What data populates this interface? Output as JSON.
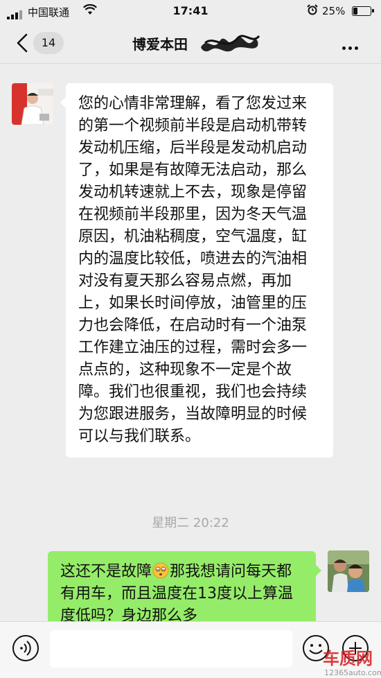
{
  "status_bar": {
    "carrier": "中国联通",
    "time": "17:41",
    "battery_percent": "25%",
    "battery_level": 0.25,
    "icons": [
      "signal-icon",
      "wifi-icon",
      "alarm-icon",
      "battery-icon"
    ]
  },
  "header": {
    "back_icon": "chevron-left-icon",
    "unread_count": "14",
    "title": "博爱本田",
    "more_icon": "ellipsis-icon"
  },
  "messages": [
    {
      "side": "left",
      "text": "您的心情非常理解，看了您发过来的第一个视频前半段是启动机带转发动机压缩，后半段是发动机启动了，如果是有故障无法启动，那么发动机转速就上不去，现象是停留在视频前半段那里，因为冬天气温原因，机油粘稠度，空气温度，缸内的温度比较低，喷进去的汽油相对没有夏天那么容易点燃，再加上，如果长时间停放，油管里的压力也会降低，在启动时有一个油泵工作建立油压的过程，需时会多一点点的，这种现象不一定是个故障。我们也很重视，我们也会持续为您跟进服务，当故障明显的时候可以与我们联系。"
    },
    {
      "side": "right",
      "text_before_emoji": "这还不是故障",
      "emoji": "dizzy-face-emoji",
      "text_after_emoji": "那我想请问每天都有用车，而且温度在13度以上算温度低吗？身边那么多"
    }
  ],
  "timestamp": "星期二 20:22",
  "input_bar": {
    "voice_icon": "voice-icon",
    "emoji_icon": "emoji-icon",
    "plus_icon": "plus-circle-icon"
  },
  "watermark": {
    "logo_text": "车质网",
    "url": "12365auto.com"
  },
  "colors": {
    "background": "#ededed",
    "self_bubble": "#95ec69",
    "other_bubble": "#ffffff",
    "timestamp": "#a8a8a8"
  }
}
